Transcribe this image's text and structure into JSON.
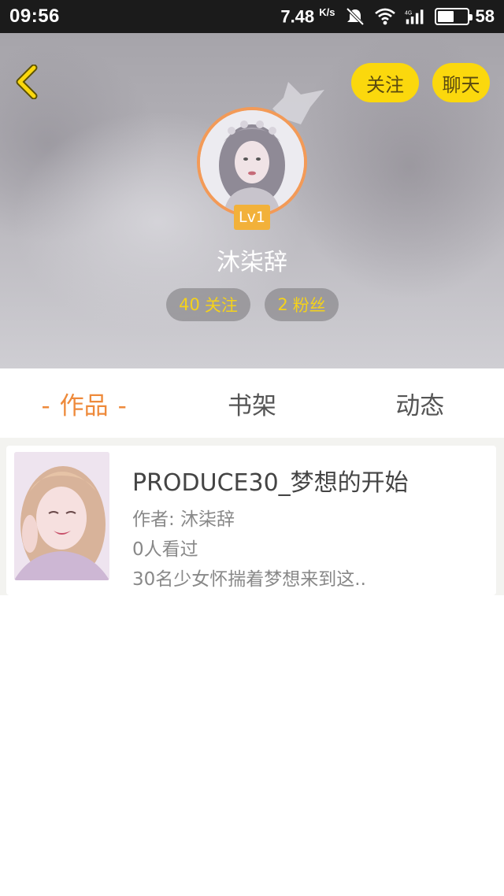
{
  "status_bar": {
    "time": "09:56",
    "speed_value": "7.48",
    "speed_unit": "K/s",
    "network_label": "4G",
    "battery_level": "58"
  },
  "header": {
    "back_icon": "chevron-left-icon",
    "follow_label": "关注",
    "chat_label": "聊天",
    "level": "Lv1",
    "username": "沐柒辞",
    "following_count": "40",
    "following_label": "关注",
    "fans_count": "2",
    "fans_label": "粉丝",
    "accent_color": "#fbd80d",
    "avatar_border_color": "#f39a57"
  },
  "tabs": [
    {
      "label": "作品",
      "active": true
    },
    {
      "label": "书架",
      "active": false
    },
    {
      "label": "动态",
      "active": false
    }
  ],
  "tab_active_marker": "-",
  "works": [
    {
      "title": "PRODUCE30_梦想的开始",
      "author": "作者: 沐柒辞",
      "views": "0人看过",
      "description": "30名少女怀揣着梦想来到这.."
    }
  ]
}
